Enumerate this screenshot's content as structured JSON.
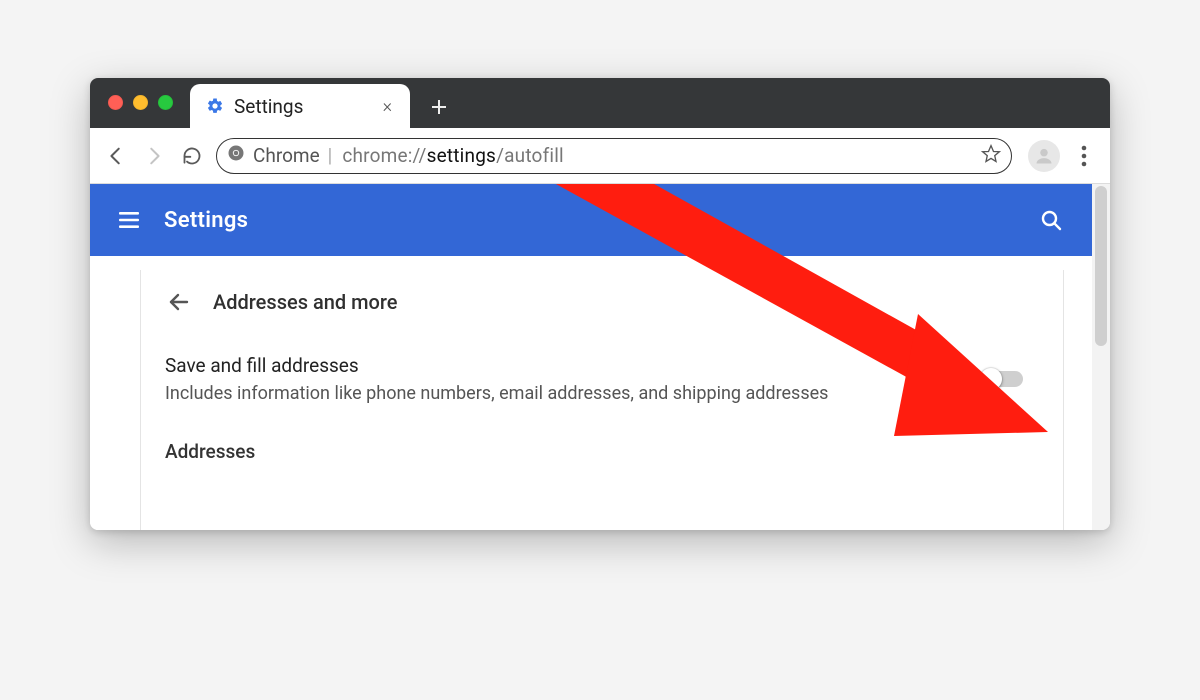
{
  "tab": {
    "title": "Settings"
  },
  "omnibox": {
    "scheme_label": "Chrome",
    "url_prefix": "chrome://",
    "url_dark": "settings",
    "url_suffix": "/autofill"
  },
  "bluebar": {
    "title": "Settings"
  },
  "section": {
    "title": "Addresses and more"
  },
  "setting": {
    "label": "Save and fill addresses",
    "description": "Includes information like phone numbers, email addresses, and shipping addresses",
    "enabled": false
  },
  "subsection": {
    "title": "Addresses"
  }
}
